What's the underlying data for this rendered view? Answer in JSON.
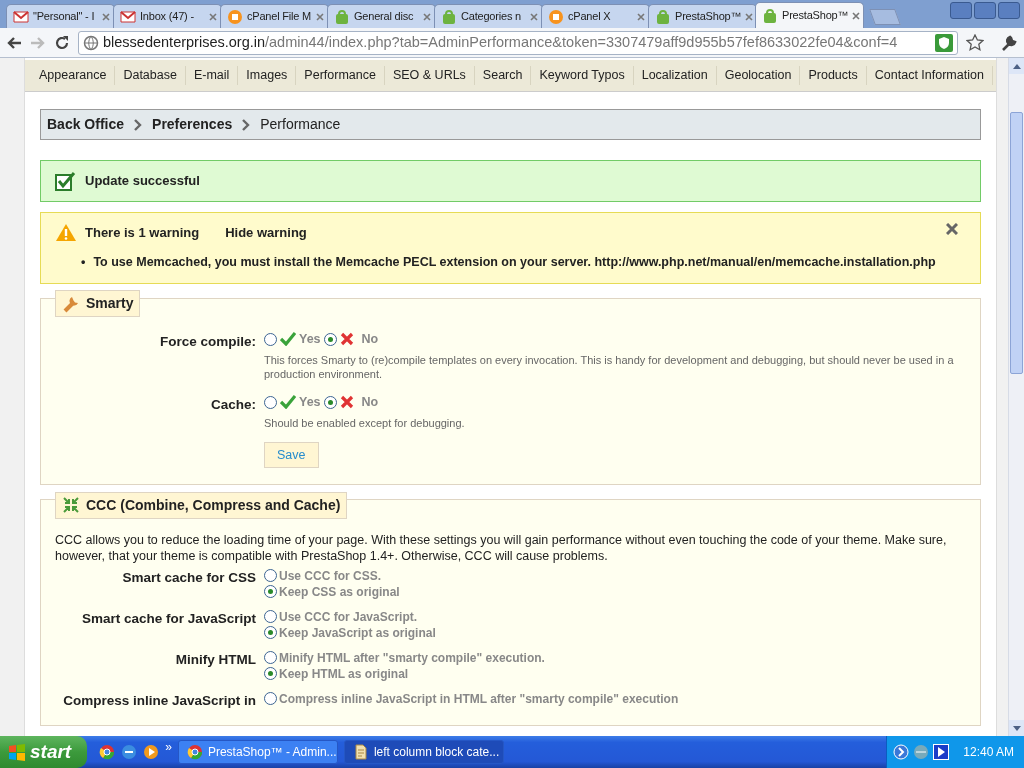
{
  "browser": {
    "tabs": [
      {
        "title": "\"Personal\" - I",
        "kind": "mail",
        "selected": false
      },
      {
        "title": "Inbox (47) -",
        "kind": "mail",
        "selected": false
      },
      {
        "title": "cPanel File M",
        "kind": "cpanel",
        "selected": false
      },
      {
        "title": "General disc",
        "kind": "shop",
        "selected": false
      },
      {
        "title": "Categories n",
        "kind": "shop",
        "selected": false
      },
      {
        "title": "cPanel X",
        "kind": "cpanel",
        "selected": false
      },
      {
        "title": "PrestaShop™",
        "kind": "shop",
        "selected": false
      },
      {
        "title": "PrestaShop™",
        "kind": "shop",
        "selected": true
      }
    ],
    "url_host": "blessedenterprises.org.in",
    "url_path": "/admin44/index.php?tab=AdminPerformance&token=3307479aff9d955b57fef8633022fe04&conf=4"
  },
  "subtabs": [
    "Appearance",
    "Database",
    "E-mail",
    "Images",
    "Performance",
    "SEO & URLs",
    "Search",
    "Keyword Typos",
    "Localization",
    "Geolocation",
    "Products",
    "Contact Information"
  ],
  "breadcrumb": [
    "Back Office",
    "Preferences",
    "Performance"
  ],
  "success": "Update successful",
  "warning": {
    "title": "There is 1 warning",
    "toggle": "Hide warning",
    "items": [
      {
        "bullet": "•",
        "text": "To use Memcached, you must install the Memcache PECL extension on your server.",
        "link": "http://www.php.net/manual/en/memcache.installation.php"
      }
    ]
  },
  "smarty": {
    "legend": "Smarty",
    "fields": [
      {
        "label": "Force compile:",
        "yes": "Yes",
        "no": "No",
        "yes_selected": false,
        "no_selected": true,
        "hint": "This forces Smarty to (re)compile templates on every invocation. This is handy for development and debugging, but should never be used in a production environment."
      },
      {
        "label": "Cache:",
        "yes": "Yes",
        "no": "No",
        "yes_selected": false,
        "no_selected": true,
        "hint": "Should be enabled except for debugging."
      }
    ],
    "save": "Save"
  },
  "ccc": {
    "legend": "CCC (Combine, Compress and Cache)",
    "intro": "CCC allows you to reduce the loading time of your page. With these settings you will gain performance without even touching the code of your theme. Make sure, however, that your theme is compatible with PrestaShop 1.4+. Otherwise, CCC will cause problems.",
    "fields": [
      {
        "label": "Smart cache for CSS",
        "options": [
          {
            "label": "Use CCC for CSS.",
            "selected": false
          },
          {
            "label": "Keep CSS as original",
            "selected": true
          }
        ]
      },
      {
        "label": "Smart cache for JavaScript",
        "options": [
          {
            "label": "Use CCC for JavaScript.",
            "selected": false
          },
          {
            "label": "Keep JavaScript as original",
            "selected": true
          }
        ]
      },
      {
        "label": "Minify HTML",
        "options": [
          {
            "label": "Minify HTML after \"smarty compile\" execution.",
            "selected": false
          },
          {
            "label": "Keep HTML as original",
            "selected": true
          }
        ]
      },
      {
        "label": "Compress inline JavaScript in",
        "options": [
          {
            "label": "Compress inline JavaScript in HTML after \"smarty compile\" execution",
            "selected": false
          }
        ]
      }
    ]
  },
  "taskbar": {
    "start": "start",
    "more": "»",
    "tasks": [
      {
        "title": "PrestaShop™ - Admin...",
        "kind": "chrome",
        "selected": false
      },
      {
        "title": "left column block cate...",
        "kind": "doc",
        "selected": true
      }
    ],
    "clock": "12:40 AM"
  }
}
